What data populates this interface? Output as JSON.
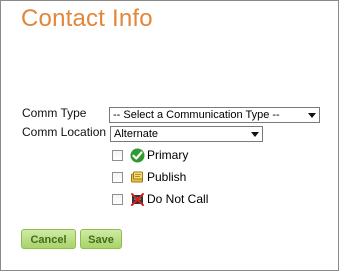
{
  "title": "Contact Info",
  "form": {
    "comm_type_label": "Comm Type",
    "comm_type_value": "-- Select a Communication Type --",
    "comm_location_label": "Comm Location",
    "comm_location_value": "Alternate"
  },
  "options": {
    "primary_label": "Primary",
    "publish_label": "Publish",
    "do_not_call_label": "Do Not Call"
  },
  "buttons": {
    "cancel_label": "Cancel",
    "save_label": "Save"
  },
  "colors": {
    "title": "#e2863a",
    "button_fill": "#a9d36a",
    "button_text": "#3f6f15"
  }
}
